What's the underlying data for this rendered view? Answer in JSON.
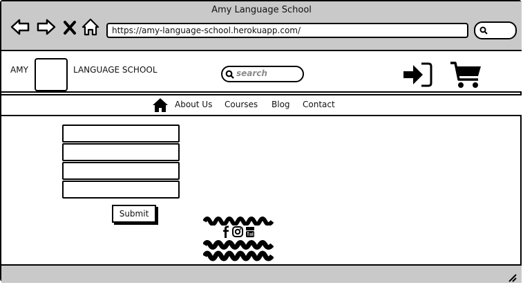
{
  "browser": {
    "title": "Amy Language School",
    "url": "https://amy-language-school.herokuapp.com/",
    "icons": [
      "back-arrow-icon",
      "forward-arrow-icon",
      "close-icon",
      "home-icon",
      "search-icon"
    ]
  },
  "header": {
    "brand_left": "AMY",
    "brand_right": "LANGUAGE SCHOOL",
    "search_placeholder": "search",
    "icons": [
      "logo-placeholder",
      "login-icon",
      "cart-icon"
    ]
  },
  "nav": {
    "items": [
      {
        "label": "About Us"
      },
      {
        "label": "Courses"
      },
      {
        "label": "Blog"
      },
      {
        "label": "Contact"
      }
    ]
  },
  "form": {
    "field_count": 4,
    "submit_label": "Submit"
  },
  "footer": {
    "social_icons": [
      "facebook-icon",
      "instagram-icon",
      "youtube-icon"
    ]
  }
}
